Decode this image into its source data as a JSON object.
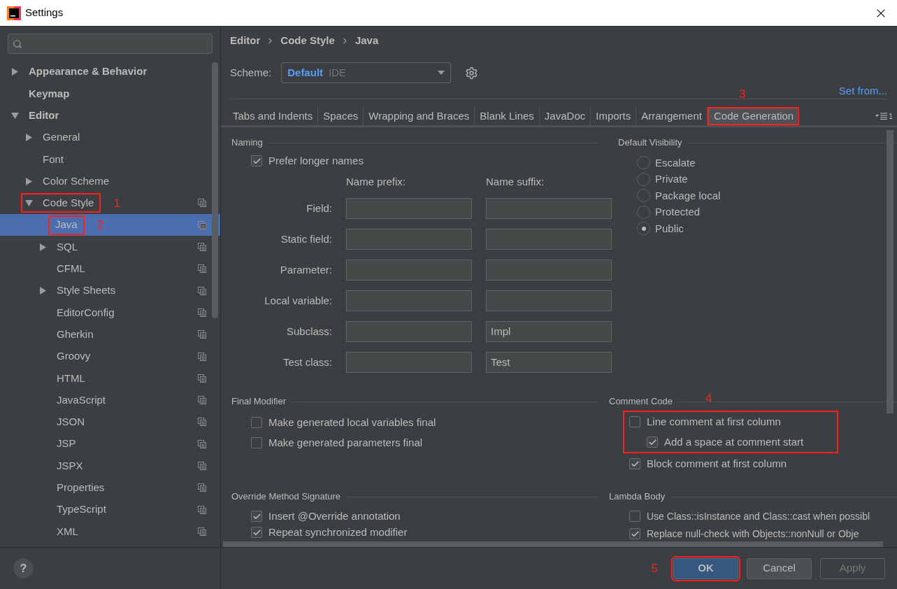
{
  "window": {
    "title": "Settings"
  },
  "tree": [
    {
      "label": "Appearance & Behavior",
      "expanded": false,
      "selected": false,
      "copy_icon": false
    },
    {
      "label": "Keymap",
      "selected": false,
      "copy_icon": false
    },
    {
      "label": "Editor",
      "expanded": true,
      "selected": false,
      "copy_icon": false,
      "children": [
        {
          "label": "General",
          "expanded": false,
          "selected": false,
          "copy_icon": false
        },
        {
          "label": "Font",
          "selected": false,
          "copy_icon": false
        },
        {
          "label": "Color Scheme",
          "expanded": false,
          "selected": false,
          "copy_icon": false
        },
        {
          "label": "Code Style",
          "expanded": true,
          "selected": false,
          "copy_icon": true,
          "annotation": "1",
          "children": [
            {
              "label": "Java",
              "selected": true,
              "copy_icon": true,
              "annotation": "2"
            },
            {
              "label": "SQL",
              "expanded": false,
              "selected": false,
              "copy_icon": true
            },
            {
              "label": "CFML",
              "selected": false,
              "copy_icon": true
            },
            {
              "label": "Style Sheets",
              "expanded": false,
              "selected": false,
              "copy_icon": true
            },
            {
              "label": "EditorConfig",
              "selected": false,
              "copy_icon": true
            },
            {
              "label": "Gherkin",
              "selected": false,
              "copy_icon": true
            },
            {
              "label": "Groovy",
              "selected": false,
              "copy_icon": true
            },
            {
              "label": "HTML",
              "selected": false,
              "copy_icon": true
            },
            {
              "label": "JavaScript",
              "selected": false,
              "copy_icon": true
            },
            {
              "label": "JSON",
              "selected": false,
              "copy_icon": true
            },
            {
              "label": "JSP",
              "selected": false,
              "copy_icon": true
            },
            {
              "label": "JSPX",
              "selected": false,
              "copy_icon": true
            },
            {
              "label": "Properties",
              "selected": false,
              "copy_icon": true
            },
            {
              "label": "TypeScript",
              "selected": false,
              "copy_icon": true
            },
            {
              "label": "XML",
              "selected": false,
              "copy_icon": true
            }
          ]
        }
      ]
    }
  ],
  "help": "?",
  "breadcrumb": [
    "Editor",
    "Code Style",
    "Java"
  ],
  "scheme": {
    "label": "Scheme:",
    "value": "Default",
    "qualifier": "IDE"
  },
  "set_from": "Set from...",
  "tabs": [
    {
      "label": "Tabs and Indents",
      "selected": false
    },
    {
      "label": "Spaces",
      "selected": false
    },
    {
      "label": "Wrapping and Braces",
      "selected": false
    },
    {
      "label": "Blank Lines",
      "selected": false
    },
    {
      "label": "JavaDoc",
      "selected": false
    },
    {
      "label": "Imports",
      "selected": false
    },
    {
      "label": "Arrangement",
      "selected": false
    },
    {
      "label": "Code Generation",
      "selected": true,
      "annotation": "3"
    }
  ],
  "tabs_overflow_count": "1",
  "naming": {
    "title": "Naming",
    "prefer_longer": {
      "label": "Prefer longer names",
      "checked": true
    },
    "prefix_header": "Name prefix:",
    "suffix_header": "Name suffix:",
    "rows": [
      {
        "label": "Field:"
      },
      {
        "label": "Static field:"
      },
      {
        "label": "Parameter:"
      },
      {
        "label": "Local variable:"
      },
      {
        "label": "Subclass:",
        "suffix": "Impl"
      },
      {
        "label": "Test class:",
        "suffix": "Test"
      }
    ]
  },
  "default_visibility": {
    "title": "Default Visibility",
    "options": [
      {
        "label": "Escalate",
        "selected": false
      },
      {
        "label": "Private",
        "selected": false
      },
      {
        "label": "Package local",
        "selected": false
      },
      {
        "label": "Protected",
        "selected": false
      },
      {
        "label": "Public",
        "selected": true
      }
    ]
  },
  "final_modifier": {
    "title": "Final Modifier",
    "options": [
      {
        "label": "Make generated local variables final",
        "checked": false
      },
      {
        "label": "Make generated parameters final",
        "checked": false
      }
    ]
  },
  "comment_code": {
    "title": "Comment Code",
    "annotation": "4",
    "options": [
      {
        "label": "Line comment at first column",
        "checked": false,
        "children": [
          {
            "label": "Add a space at comment start",
            "checked": true
          }
        ]
      }
    ],
    "after": [
      {
        "label": "Block comment at first column",
        "checked": true
      }
    ]
  },
  "override": {
    "title": "Override Method Signature",
    "options": [
      {
        "label": "Insert @Override annotation",
        "checked": true
      },
      {
        "label": "Repeat synchronized modifier",
        "checked": true
      }
    ]
  },
  "lambda": {
    "title": "Lambda Body",
    "options": [
      {
        "label": "Use Class::isInstance and Class::cast when possibl",
        "checked": false
      },
      {
        "label": "Replace null-check with Objects::nonNull or Obje",
        "checked": true
      }
    ]
  },
  "buttons": [
    {
      "label": "OK",
      "kind": "primary",
      "annotation": "5"
    },
    {
      "label": "Cancel",
      "kind": "normal"
    },
    {
      "label": "Apply",
      "kind": "disabled"
    }
  ]
}
